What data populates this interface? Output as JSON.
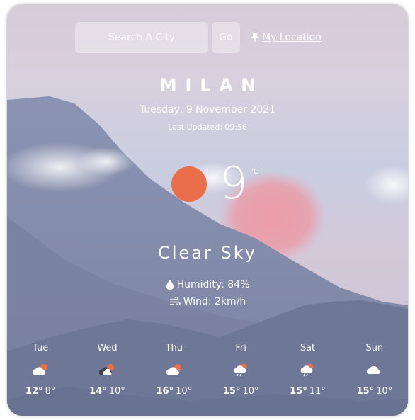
{
  "search": {
    "placeholder": "Search A City",
    "go_label": "Go",
    "location_label": "My Location"
  },
  "weather": {
    "city": "MILAN",
    "date": "Tuesday, 9 November 2021",
    "last_updated_label": "Last Updated:",
    "last_updated_time": "09:56",
    "temperature": "9",
    "unit": "°C",
    "condition": "Clear Sky",
    "humidity_label": "Humidity:",
    "humidity_value": "84%",
    "wind_label": "Wind:",
    "wind_value": "2km/h"
  },
  "forecast": [
    {
      "day": "Tue",
      "high": "12°",
      "low": "8°",
      "icon": "partly-cloudy-icon"
    },
    {
      "day": "Wed",
      "high": "14°",
      "low": "10°",
      "icon": "dark-cloud-sun-icon"
    },
    {
      "day": "Thu",
      "high": "16°",
      "low": "10°",
      "icon": "partly-cloudy-icon"
    },
    {
      "day": "Fri",
      "high": "15°",
      "low": "10°",
      "icon": "rain-sun-icon"
    },
    {
      "day": "Sat",
      "high": "15°",
      "low": "11°",
      "icon": "rain-sun-icon"
    },
    {
      "day": "Sun",
      "high": "15°",
      "low": "10°",
      "icon": "cloud-icon"
    }
  ],
  "colors": {
    "sun": "#eb6e4b",
    "text": "#ffffff",
    "mountain": "#7f87a6"
  }
}
